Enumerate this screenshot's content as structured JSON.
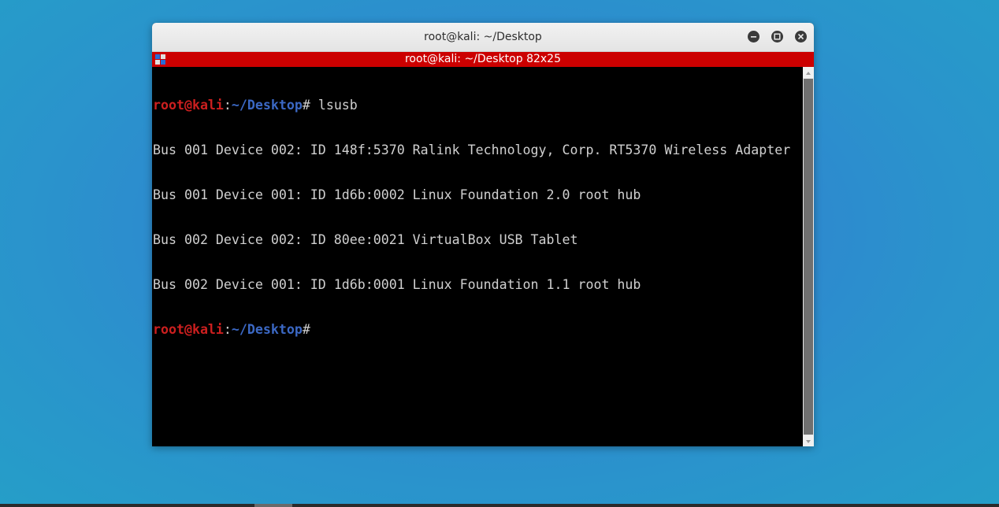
{
  "window": {
    "title": "root@kali: ~/Desktop"
  },
  "tab": {
    "title": "root@kali: ~/Desktop 82x25"
  },
  "terminal": {
    "prompt_user": "root@kali",
    "prompt_colon": ":",
    "prompt_path": "~/Desktop",
    "prompt_hash": "#",
    "command": " lsusb",
    "output": [
      "Bus 001 Device 002: ID 148f:5370 Ralink Technology, Corp. RT5370 Wireless Adapter",
      "Bus 001 Device 001: ID 1d6b:0002 Linux Foundation 2.0 root hub",
      "Bus 002 Device 002: ID 80ee:0021 VirtualBox USB Tablet",
      "Bus 002 Device 001: ID 1d6b:0001 Linux Foundation 1.1 root hub"
    ]
  },
  "icons": {
    "minimize": "minimize-icon",
    "maximize": "maximize-icon",
    "close": "close-icon",
    "tab": "terminal-tab-icon"
  },
  "colors": {
    "tab_bar": "#cc0000",
    "prompt_user": "#cc1f1f",
    "prompt_path": "#3b68c4",
    "terminal_bg": "#000000",
    "terminal_fg": "#d0d0d0"
  }
}
